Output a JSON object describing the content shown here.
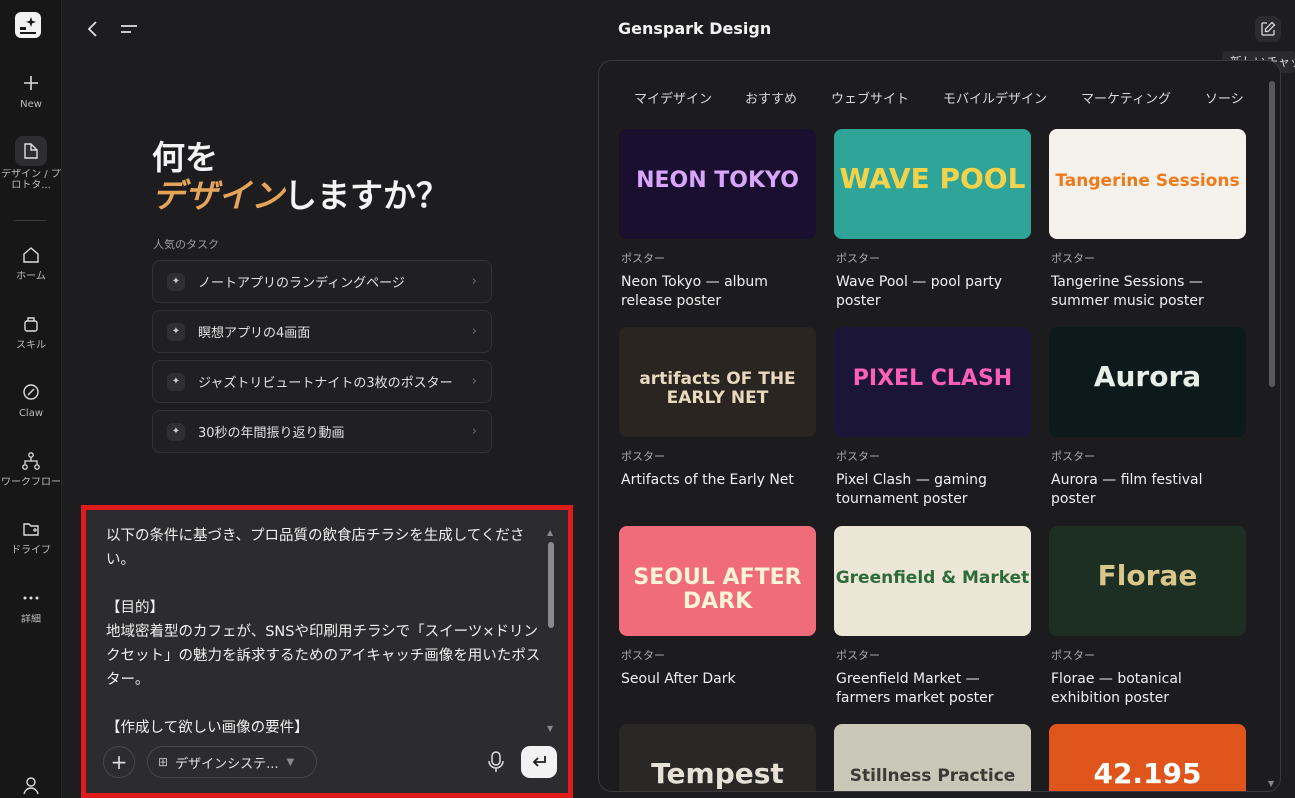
{
  "app": {
    "title": "Genspark Design",
    "tooltip": "新しいチャット"
  },
  "sidebar": {
    "items": [
      {
        "label": "New",
        "icon": "plus-icon"
      },
      {
        "label": "デザイン / プロトタ...",
        "icon": "design-icon"
      },
      {
        "label": "ホーム",
        "icon": "home-icon"
      },
      {
        "label": "スキル",
        "icon": "skill-icon"
      },
      {
        "label": "Claw",
        "icon": "claw-icon"
      },
      {
        "label": "ワークフロー",
        "icon": "workflow-icon"
      },
      {
        "label": "ドライブ",
        "icon": "drive-icon"
      },
      {
        "label": "詳細",
        "icon": "more-icon"
      }
    ]
  },
  "hero": {
    "line1": "何を",
    "accent": "デザイン",
    "rest": "しますか？",
    "popular_label": "人気のタスク"
  },
  "tasks": [
    {
      "label": "ノートアプリのランディングページ"
    },
    {
      "label": "瞑想アプリの4画面"
    },
    {
      "label": "ジャズトリビュートナイトの3枚のポスター"
    },
    {
      "label": "30秒の年間振り返り動画"
    }
  ],
  "composer": {
    "text": "以下の条件に基づき、プロ品質の飲食店チラシを生成してください。\n\n【目的】\n地域密着型のカフェが、SNSや印刷用チラシで「スイーツ×ドリンクセット」の魅力を訴求するためのアイキャッチ画像を用いたポスター。\n\n【作成して欲しい画像の要件】",
    "design_system_label": "デザインシステ..."
  },
  "gallery": {
    "tabs": [
      "マイデザイン",
      "おすすめ",
      "ウェブサイト",
      "モバイルデザイン",
      "マーケティング",
      "ソーシ"
    ],
    "cards": [
      {
        "category": "ポスター",
        "title": "Neon Tokyo — album release poster",
        "art": "NEON TOKYO",
        "colors": {
          "bg": "#1a0f2e",
          "fg": "#d8a6ff"
        }
      },
      {
        "category": "ポスター",
        "title": "Wave Pool — pool party poster",
        "art": "WAVE POOL",
        "colors": {
          "bg": "#2fa59a",
          "fg": "#f4d34a"
        }
      },
      {
        "category": "ポスター",
        "title": "Tangerine Sessions — summer music poster",
        "art": "Tangerine Sessions",
        "colors": {
          "bg": "#f5f1ec",
          "fg": "#f07a1a"
        }
      },
      {
        "category": "ポスター",
        "title": "Artifacts of the Early Net",
        "art": "artifacts OF THE EARLY NET",
        "colors": {
          "bg": "#2a2520",
          "fg": "#e9d9bf"
        }
      },
      {
        "category": "ポスター",
        "title": "Pixel Clash — gaming tournament poster",
        "art": "PIXEL CLASH",
        "colors": {
          "bg": "#1b1537",
          "fg": "#ff5fb8"
        }
      },
      {
        "category": "ポスター",
        "title": "Aurora — film festival poster",
        "art": "Aurora",
        "colors": {
          "bg": "#0d1a1c",
          "fg": "#e8efe8"
        }
      },
      {
        "category": "ポスター",
        "title": "Seoul After Dark",
        "art": "SEOUL AFTER DARK",
        "colors": {
          "bg": "#f06c7b",
          "fg": "#fff4d6"
        }
      },
      {
        "category": "ポスター",
        "title": "Greenfield Market — farmers market poster",
        "art": "Greenfield & Market",
        "colors": {
          "bg": "#ece6d6",
          "fg": "#2e6b3a"
        }
      },
      {
        "category": "ポスター",
        "title": "Florae — botanical exhibition poster",
        "art": "Florae",
        "colors": {
          "bg": "#1c2f22",
          "fg": "#d8c68a"
        }
      },
      {
        "category": "",
        "title": "",
        "art": "Tempest",
        "colors": {
          "bg": "#2a2826",
          "fg": "#e6e0d6"
        }
      },
      {
        "category": "",
        "title": "",
        "art": "Stillness Practice",
        "colors": {
          "bg": "#c9c7b8",
          "fg": "#3a3a36"
        }
      },
      {
        "category": "",
        "title": "",
        "art": "42.195",
        "colors": {
          "bg": "#e0551c",
          "fg": "#ffffff"
        }
      }
    ]
  }
}
